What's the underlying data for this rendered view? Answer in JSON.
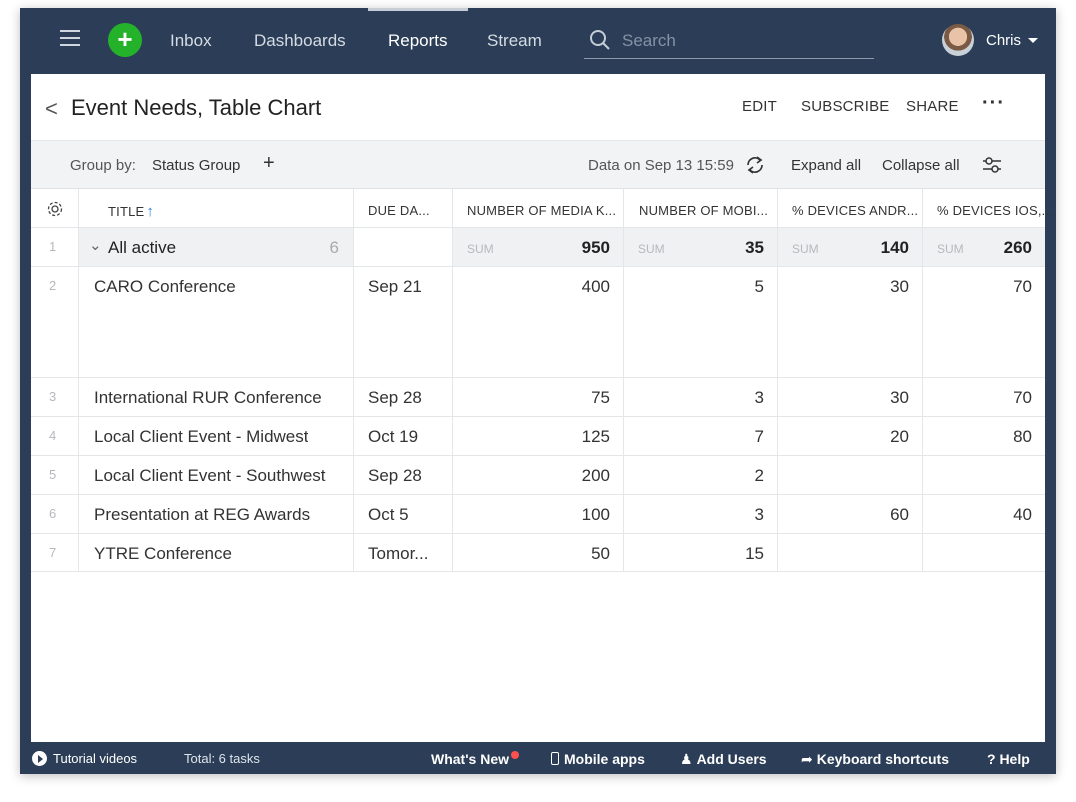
{
  "nav": {
    "items": [
      {
        "label": "Inbox",
        "active": false
      },
      {
        "label": "Dashboards",
        "active": false
      },
      {
        "label": "Reports",
        "active": true
      },
      {
        "label": "Stream",
        "active": false
      }
    ],
    "search_placeholder": "Search",
    "user_name": "Chris"
  },
  "header": {
    "title": "Event Needs, Table Chart",
    "actions": {
      "edit": "EDIT",
      "subscribe": "SUBSCRIBE",
      "share": "SHARE",
      "more": "···"
    }
  },
  "toolbar": {
    "group_by_label": "Group by:",
    "group_by_value": "Status Group",
    "add": "+",
    "data_on": "Data on Sep 13 15:59",
    "expand_all": "Expand all",
    "collapse_all": "Collapse all"
  },
  "table": {
    "columns": [
      "TITLE",
      "DUE DA...",
      "NUMBER OF MEDIA K...",
      "NUMBER OF MOBI...",
      "% DEVICES ANDR...",
      "% DEVICES IOS,..."
    ],
    "sort_arrow": "↑",
    "group": {
      "index": "1",
      "chevron": "⌄",
      "title": "All active",
      "count": "6",
      "sum_label": "SUM",
      "sums": [
        "950",
        "35",
        "140",
        "260"
      ]
    },
    "rows": [
      {
        "index": "2",
        "title": "CARO Conference",
        "due": "Sep 21",
        "media": "400",
        "mobile": "5",
        "android": "30",
        "ios": "70"
      },
      {
        "index": "3",
        "title": "International RUR Conference",
        "due": "Sep 28",
        "media": "75",
        "mobile": "3",
        "android": "30",
        "ios": "70"
      },
      {
        "index": "4",
        "title": "Local Client Event - Midwest",
        "due": "Oct 19",
        "media": "125",
        "mobile": "7",
        "android": "20",
        "ios": "80"
      },
      {
        "index": "5",
        "title": "Local Client Event - Southwest",
        "due": "Sep 28",
        "media": "200",
        "mobile": "2",
        "android": "",
        "ios": ""
      },
      {
        "index": "6",
        "title": "Presentation at REG Awards",
        "due": "Oct 5",
        "media": "100",
        "mobile": "3",
        "android": "60",
        "ios": "40"
      },
      {
        "index": "7",
        "title": "YTRE Conference",
        "due": "Tomor...",
        "media": "50",
        "mobile": "15",
        "android": "",
        "ios": ""
      }
    ]
  },
  "footer": {
    "tutorial": "Tutorial videos",
    "total": "Total: 6 tasks",
    "whats_new": "What's New",
    "mobile_apps": "Mobile apps",
    "add_users": "Add Users",
    "shortcuts": "Keyboard shortcuts",
    "help": "? Help"
  },
  "colors": {
    "nav_bg": "#2c3e57",
    "accent_green": "#25b22b",
    "sort_blue": "#2f7fd6",
    "notification_red": "#ff4f4f"
  }
}
